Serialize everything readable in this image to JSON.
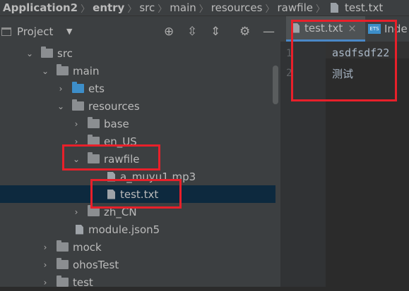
{
  "breadcrumb": [
    "Application2",
    "entry",
    "src",
    "main",
    "resources",
    "rawfile",
    "test.txt"
  ],
  "project_panel": {
    "title": "Project",
    "dropdown": "▼"
  },
  "tree": [
    {
      "label": "src",
      "arrow": "⌄",
      "kind": "folder"
    },
    {
      "label": "main",
      "arrow": "⌄",
      "kind": "folder"
    },
    {
      "label": "ets",
      "arrow": "›",
      "kind": "folder-blue"
    },
    {
      "label": "resources",
      "arrow": "⌄",
      "kind": "folder"
    },
    {
      "label": "base",
      "arrow": "›",
      "kind": "folder"
    },
    {
      "label": "en_US",
      "arrow": "›",
      "kind": "folder"
    },
    {
      "label": "rawfile",
      "arrow": "⌄",
      "kind": "folder"
    },
    {
      "label": "a_muyu1.mp3",
      "arrow": "",
      "kind": "file"
    },
    {
      "label": "test.txt",
      "arrow": "",
      "kind": "file",
      "selected": true
    },
    {
      "label": "zh_CN",
      "arrow": "›",
      "kind": "folder"
    },
    {
      "label": "module.json5",
      "arrow": "",
      "kind": "file"
    },
    {
      "label": "mock",
      "arrow": "›",
      "kind": "folder"
    },
    {
      "label": "ohosTest",
      "arrow": "›",
      "kind": "folder"
    },
    {
      "label": "test",
      "arrow": "›",
      "kind": "folder"
    }
  ],
  "tabs": [
    {
      "label": "test.txt",
      "close": "×",
      "active": true
    },
    {
      "label": "Inde",
      "active": false
    }
  ],
  "editor": {
    "line_numbers": [
      "1",
      "2"
    ],
    "lines": [
      "asdfsdf22",
      "测试"
    ]
  },
  "colors": {
    "highlight_box": "#e8202a",
    "selection": "#0d293e"
  }
}
